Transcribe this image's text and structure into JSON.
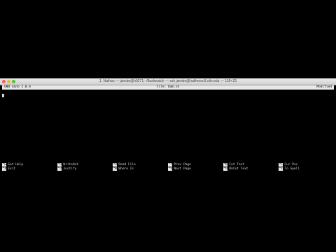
{
  "window": {
    "title": "1. Nathan — jaimbe@h9271:~/flashwatch — ssh jaimbe@halfmoon3.olin.edu — 160×23"
  },
  "nano": {
    "version": "GNU nano 2.0.6",
    "file": "File: bam.sh",
    "status": "Modified"
  },
  "shortcuts": [
    {
      "key": "^G",
      "label": "Get Help"
    },
    {
      "key": "^O",
      "label": "WriteOut"
    },
    {
      "key": "^R",
      "label": "Read File"
    },
    {
      "key": "^Y",
      "label": "Prev Page"
    },
    {
      "key": "^K",
      "label": "Cut Text"
    },
    {
      "key": "^C",
      "label": "Cur Pos"
    },
    {
      "key": "^X",
      "label": "Exit"
    },
    {
      "key": "^J",
      "label": "Justify"
    },
    {
      "key": "^W",
      "label": "Where Is"
    },
    {
      "key": "^V",
      "label": "Next Page"
    },
    {
      "key": "^U",
      "label": "UnCut Text"
    },
    {
      "key": "^T",
      "label": "To Spell"
    }
  ]
}
